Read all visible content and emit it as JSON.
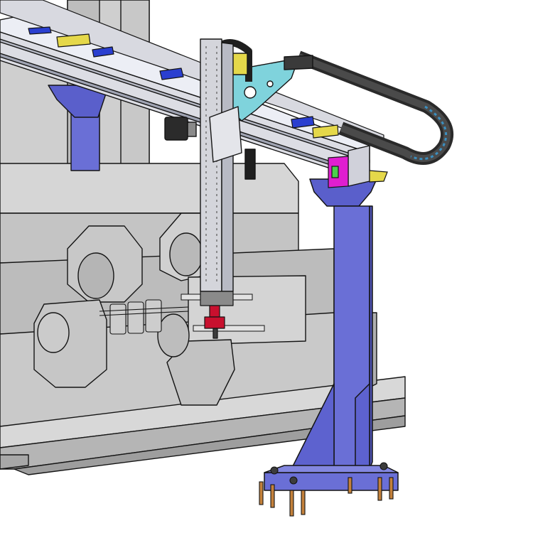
{
  "scene": {
    "kind": "cad-assembly-render",
    "components": [
      "machine-tool-base",
      "workpiece-fixture-left",
      "workpiece-fixture-right",
      "gantry-beam",
      "support-column",
      "vertical-z-axis",
      "gripper",
      "cable-drag-chain",
      "servo-motor"
    ]
  },
  "colors": {
    "background": "#ffffff",
    "machine_gray": "#c3c3c3",
    "machine_light": "#d9d9d9",
    "machine_dark": "#8a8a8a",
    "edge": "#141414",
    "column_blue": "#6a6fd6",
    "column_blue_dark": "#4f53b5",
    "beam_silver": "#dcdde4",
    "beam_top": "#eceef5",
    "rail_blue": "#2a3fd0",
    "bracket_cyan": "#7fd3dc",
    "yellow": "#e5d84a",
    "magenta": "#e01ed0",
    "green": "#4bd04b",
    "drag_chain": "#2a2a2a",
    "bolt_orange": "#c4813b",
    "gripper_red": "#c8102e"
  }
}
